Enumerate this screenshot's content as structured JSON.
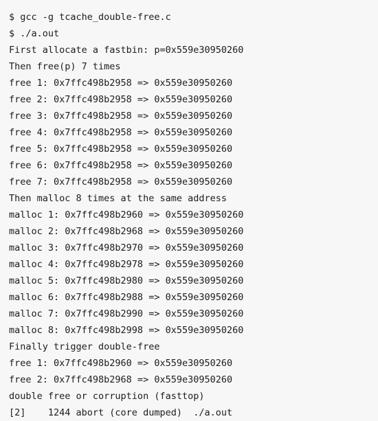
{
  "terminal": {
    "prompt_symbol": "$",
    "program_name": "./a.out",
    "source_file": "tcache_double-free.c",
    "heap_address": "0x559e30950260",
    "lines": [
      "$ gcc -g tcache_double-free.c",
      "$ ./a.out",
      "First allocate a fastbin: p=0x559e30950260",
      "Then free(p) 7 times",
      "free 1: 0x7ffc498b2958 => 0x559e30950260",
      "free 2: 0x7ffc498b2958 => 0x559e30950260",
      "free 3: 0x7ffc498b2958 => 0x559e30950260",
      "free 4: 0x7ffc498b2958 => 0x559e30950260",
      "free 5: 0x7ffc498b2958 => 0x559e30950260",
      "free 6: 0x7ffc498b2958 => 0x559e30950260",
      "free 7: 0x7ffc498b2958 => 0x559e30950260",
      "Then malloc 8 times at the same address",
      "malloc 1: 0x7ffc498b2960 => 0x559e30950260",
      "malloc 2: 0x7ffc498b2968 => 0x559e30950260",
      "malloc 3: 0x7ffc498b2970 => 0x559e30950260",
      "malloc 4: 0x7ffc498b2978 => 0x559e30950260",
      "malloc 5: 0x7ffc498b2980 => 0x559e30950260",
      "malloc 6: 0x7ffc498b2988 => 0x559e30950260",
      "malloc 7: 0x7ffc498b2990 => 0x559e30950260",
      "malloc 8: 0x7ffc498b2998 => 0x559e30950260",
      "Finally trigger double-free",
      "free 1: 0x7ffc498b2960 => 0x559e30950260",
      "free 2: 0x7ffc498b2968 => 0x559e30950260",
      "double free or corruption (fasttop)",
      "[2]    1244 abort (core dumped)  ./a.out"
    ]
  },
  "colors": {
    "background": "#f7f7f7",
    "text": "#1c1c1c"
  }
}
